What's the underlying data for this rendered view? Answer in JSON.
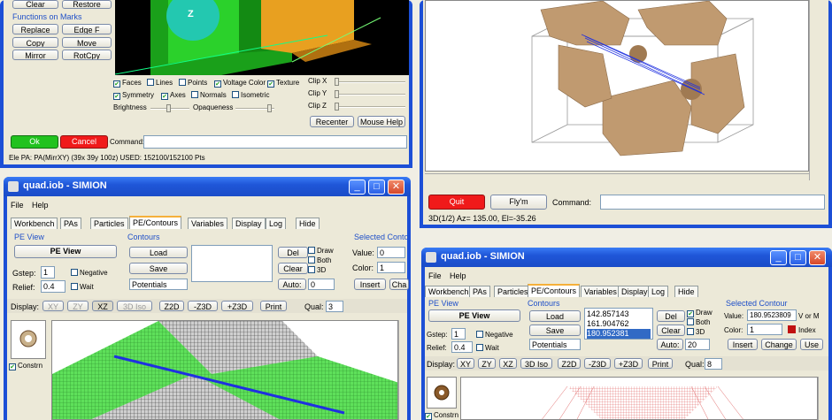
{
  "tl": {
    "clear": "Clear",
    "restore": "Restore",
    "functions_label": "Functions on Marks",
    "buttons": [
      "Replace",
      "Edge F",
      "Copy",
      "Move",
      "Mirror",
      "RotCpy"
    ],
    "checks_r1": [
      {
        "t": "Faces",
        "v": "✔"
      },
      {
        "t": "Lines",
        "v": ""
      },
      {
        "t": "Points",
        "v": ""
      },
      {
        "t": "Voltage Color",
        "v": "✔"
      },
      {
        "t": "Texture",
        "v": "✔"
      }
    ],
    "checks_r2": [
      {
        "t": "Symmetry",
        "v": "✔"
      },
      {
        "t": "Axes",
        "v": "✔"
      },
      {
        "t": "Normals",
        "v": ""
      },
      {
        "t": "Isometric",
        "v": ""
      }
    ],
    "clip": [
      "Clip X",
      "Clip Y",
      "Clip Z"
    ],
    "brightness": "Brightness",
    "opaqueness": "Opaqueness",
    "recenter": "Recenter",
    "mouse_help": "Mouse Help",
    "ok": "Ok",
    "cancel": "Cancel",
    "command": "Command:",
    "status": "Ele PA: PA(MirrXY) (39x 39y 100z)  USED: 152100/152100 Pts",
    "z_glyph": "Z"
  },
  "tr": {
    "quit": "Quit",
    "flyin": "Fly'm",
    "command": "Command:",
    "status": "3D(1/2) Az= 135.00, El=-35.26"
  },
  "bl": {
    "title": "quad.iob - SIMION",
    "menu": [
      "File",
      "Help"
    ],
    "tabs": [
      "Workbench",
      "PAs",
      "Particles",
      "PE/Contours",
      "Variables",
      "Display",
      "Log",
      "Hide"
    ],
    "pe_view_label": "PE View",
    "pe_view": "PE View",
    "gstep": "Gstep:",
    "gstep_val": "1",
    "negative": "Negative",
    "relief": "Relief:",
    "relief_val": "0.4",
    "wait": "Wait",
    "contours": "Contours",
    "load": "Load",
    "save": "Save",
    "potentials": "Potentials",
    "del": "Del",
    "clear": "Clear",
    "auto": "Auto:",
    "auto_val": "0",
    "draw": "Draw",
    "both": "Both",
    "three_d": "3D",
    "selected": "Selected Conto",
    "value": "Value:",
    "value_val": "0",
    "color": "Color:",
    "color_val": "1",
    "insert": "Insert",
    "ch": "Cha",
    "display": "Display:",
    "views": [
      "XY",
      "ZY",
      "XZ",
      "3D Iso"
    ],
    "zoom": [
      "Z2D",
      "-Z3D",
      "+Z3D"
    ],
    "print": "Print",
    "qual": "Qual:",
    "qual_val": "3",
    "constrn": "Constrn"
  },
  "br": {
    "title": "quad.iob - SIMION",
    "menu": [
      "File",
      "Help"
    ],
    "tabs": [
      "Workbench",
      "PAs",
      "Particles",
      "PE/Contours",
      "Variables",
      "Display",
      "Log",
      "Hide"
    ],
    "pe_view_label": "PE View",
    "pe_view": "PE View",
    "gstep": "Gstep:",
    "gstep_val": "1",
    "negative": "Negative",
    "relief": "Relief:",
    "relief_val": "0.4",
    "wait": "Wait",
    "contours": "Contours",
    "load": "Load",
    "save": "Save",
    "potentials": "Potentials",
    "list": [
      "142.857143",
      "161.904762",
      "180.952381"
    ],
    "del": "Del",
    "clear": "Clear",
    "auto": "Auto:",
    "auto_val": "20",
    "draw": "Draw",
    "both": "Both",
    "three_d": "3D",
    "selected": "Selected Contour",
    "value": "Value:",
    "value_val": "180.9523809",
    "vorm": "V or M",
    "color": "Color:",
    "color_val": "1",
    "index": "Index",
    "insert": "Insert",
    "change": "Change",
    "use": "Use",
    "display": "Display:",
    "views": [
      "XY",
      "ZY",
      "XZ",
      "3D Iso"
    ],
    "zoom": [
      "Z2D",
      "-Z3D",
      "+Z3D"
    ],
    "print": "Print",
    "qual": "Qual:",
    "qual_val": "8",
    "constrn": "Constrn"
  },
  "colors": {
    "ok": "#21c21e",
    "cancel": "#f01a1a",
    "quit": "#f01a1a",
    "green_mesh": "#5ee05a",
    "title_blue": "#1f56d8"
  }
}
